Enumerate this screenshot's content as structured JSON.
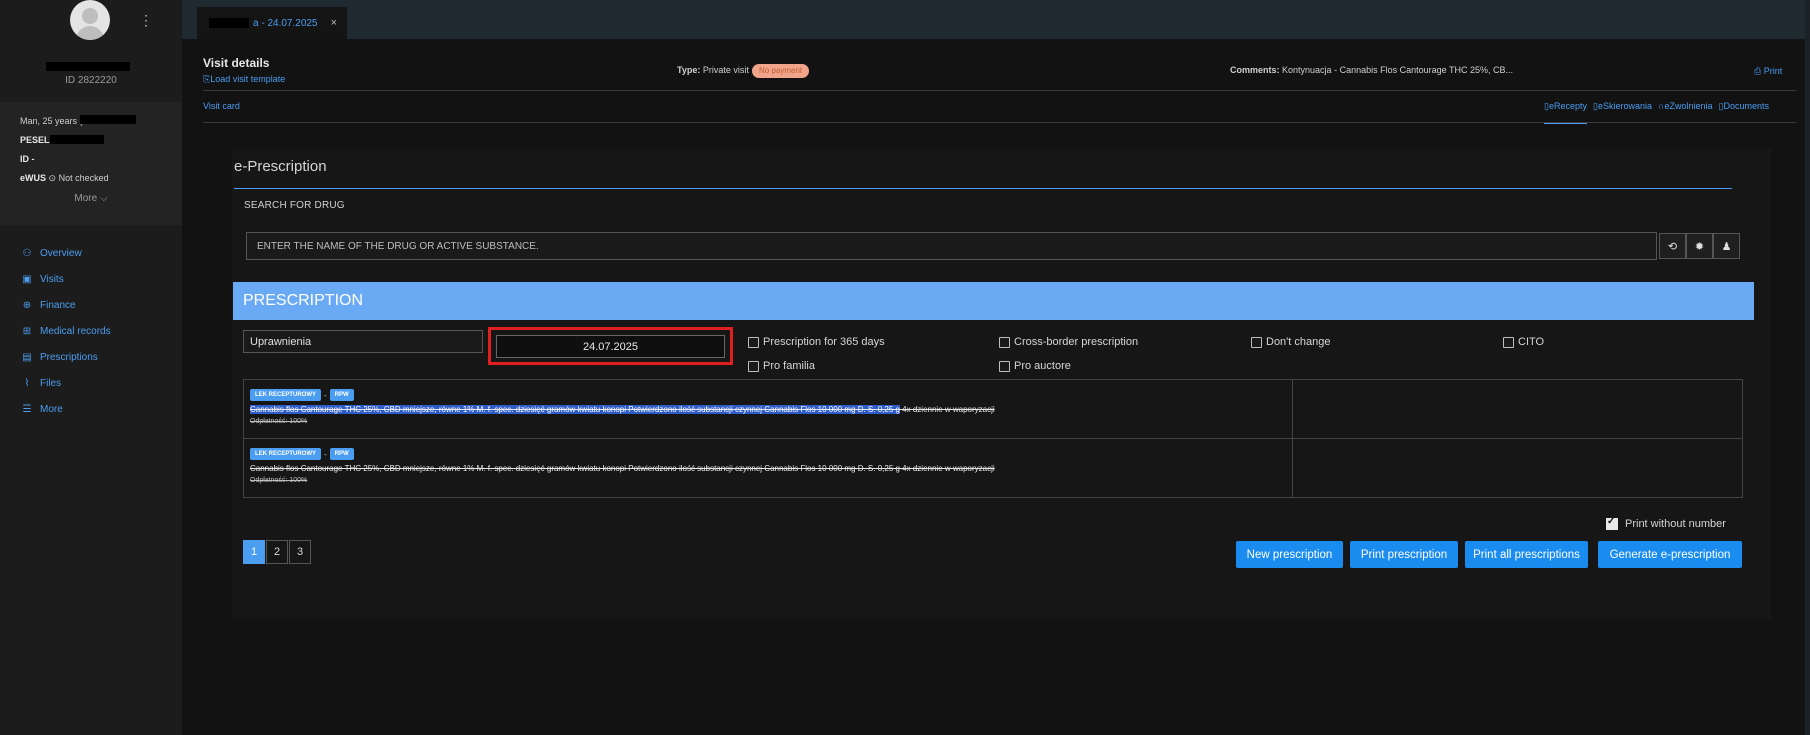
{
  "sidebar": {
    "patient_id": "ID 2822220",
    "info": {
      "sex_age": "Man, 25 years (2",
      "pesel_label": "PESEL",
      "id_label": "ID -",
      "ewus_label": "eWUS",
      "ewus_status": "Not checked"
    },
    "more_label": "More",
    "nav": [
      {
        "label": "Overview",
        "icon": "user-icon"
      },
      {
        "label": "Visits",
        "icon": "calendar-icon"
      },
      {
        "label": "Finance",
        "icon": "finance-icon"
      },
      {
        "label": "Medical records",
        "icon": "medical-records-icon"
      },
      {
        "label": "Prescriptions",
        "icon": "prescription-icon"
      },
      {
        "label": "Files",
        "icon": "paperclip-icon"
      },
      {
        "label": "More",
        "icon": "menu-icon"
      }
    ]
  },
  "tabbar": {
    "tab_label": "a - 24.07.2025",
    "close": "×"
  },
  "visit": {
    "title": "Visit details",
    "load_template": "Load visit template",
    "type_label": "Type:",
    "type_value": "Private visit",
    "payment_badge": "No payment",
    "comments_label": "Comments:",
    "comments_value": "Kontynuacja - Cannabis Flos Cantourage THC 25%, CB...",
    "print": "Print",
    "visit_card": "Visit card",
    "subtabs": [
      "eRecepty",
      "eSkierowania",
      "eZwolnienia",
      "Documents"
    ]
  },
  "eprescription": {
    "title": "e-Prescription",
    "search_label": "SEARCH FOR DRUG",
    "search_placeholder": "ENTER THE NAME OF THE DRUG OR ACTIVE SUBSTANCE.",
    "prescription_header": "PRESCRIPTION",
    "permissions_value": "Uprawnienia",
    "date_value": "24.07.2025",
    "checkboxes": {
      "p365": "Prescription for 365 days",
      "cross_border": "Cross-border prescription",
      "dont_change": "Don't change",
      "cito": "CITO",
      "pro_familia": "Pro familia",
      "pro_auctore": "Pro auctore"
    },
    "rows": [
      {
        "tag1": "LEK RECEPTUROWY",
        "sep": "-",
        "tag2": "RPW",
        "drug_highlighted": "Cannabis flos Cantourage THC 25%, CBD mniejsze, równe 1% M. f. spec. dziesięć gramów kwiatu konopi Potwierdzono ilość substancji czynnej Cannabis Flos 10 000 mg D. S. 0,25 g",
        "drug_rest": " 4x dziennie w waporyzacji",
        "payment": "Odpłatność: 100%"
      },
      {
        "tag1": "LEK RECEPTUROWY",
        "sep": "-",
        "tag2": "RPW",
        "drug": "Cannabis flos Cantourage THC 25%, CBD mniejsze, równe 1% M. f. spec. dziesięć gramów kwiatu konopi Potwierdzono ilość substancji czynnej Cannabis Flos 10 000 mg D. S. 0,25 g 4x dziennie w waporyzacji",
        "payment": "Odpłatność: 100%"
      }
    ],
    "print_without_number": "Print without number",
    "pages": [
      "1",
      "2",
      "3"
    ],
    "buttons": {
      "new": "New prescription",
      "print": "Print prescription",
      "print_all": "Print all prescriptions",
      "generate": "Generate e-prescription"
    }
  },
  "colors": {
    "accent": "#4a9df0",
    "prescription_bar": "#6aaaf5",
    "primary_button": "#1a8cf0",
    "highlight_box": "#e02020"
  }
}
